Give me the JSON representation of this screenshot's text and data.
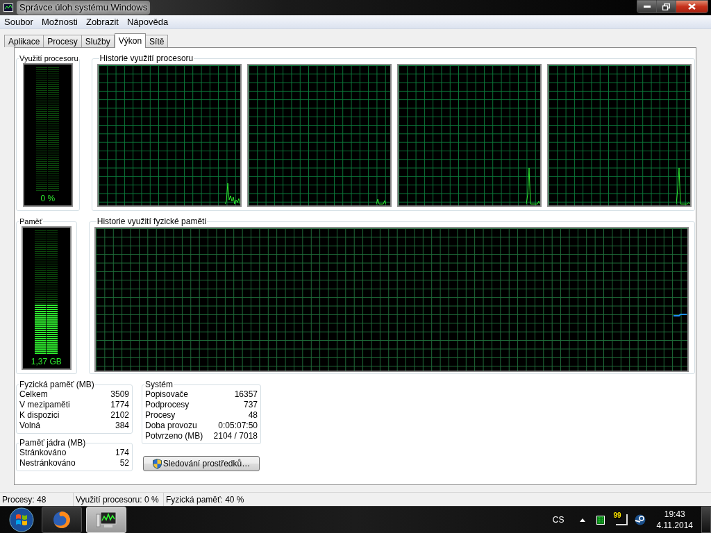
{
  "window": {
    "title": "Správce úloh systému Windows"
  },
  "menu": [
    "Soubor",
    "Možnosti",
    "Zobrazit",
    "Nápověda"
  ],
  "tabs": [
    {
      "label": "Aplikace",
      "selected": false
    },
    {
      "label": "Procesy",
      "selected": false
    },
    {
      "label": "Služby",
      "selected": false
    },
    {
      "label": "Výkon",
      "selected": true
    },
    {
      "label": "Sítě",
      "selected": false
    }
  ],
  "cpu_usage": {
    "title": "Využití procesoru",
    "level": 0,
    "reading": "0 %"
  },
  "cpu_history": {
    "title": "Historie využití procesoru"
  },
  "memory": {
    "title": "Paměť",
    "level": 0.4,
    "reading": "1,37 GB"
  },
  "memory_history": {
    "title": "Historie využití fyzické paměti"
  },
  "physical_memory": {
    "title": "Fyzická paměť (MB)",
    "rows": [
      {
        "label": "Celkem",
        "value": "3509"
      },
      {
        "label": "V mezipaměti",
        "value": "1774"
      },
      {
        "label": "K dispozici",
        "value": "2102"
      },
      {
        "label": "Volná",
        "value": "384"
      }
    ]
  },
  "kernel_memory": {
    "title": "Paměť jádra (MB)",
    "rows": [
      {
        "label": "Stránkováno",
        "value": "174"
      },
      {
        "label": "Nestránkováno",
        "value": "52"
      }
    ]
  },
  "system": {
    "title": "Systém",
    "rows": [
      {
        "label": "Popisovače",
        "value": "16357"
      },
      {
        "label": "Podprocesy",
        "value": "737"
      },
      {
        "label": "Procesy",
        "value": "48"
      },
      {
        "label": "Doba provozu",
        "value": "0:05:07:50"
      },
      {
        "label": "Potvrzeno (MB)",
        "value": "2104 / 7018"
      }
    ]
  },
  "resource_monitor_button": "Sledování prostředků…",
  "status_bar": [
    "Procesy: 48",
    "Využití procesoru: 0 %",
    "Fyzická paměť: 40 %"
  ],
  "taskbar": {
    "buttons": [
      {
        "kind": "browser",
        "selected": false
      },
      {
        "kind": "task-manager",
        "selected": true
      }
    ],
    "tray": {
      "language": "CS",
      "badge": "99",
      "time": "19:43",
      "date": "4.11.2014"
    }
  }
}
